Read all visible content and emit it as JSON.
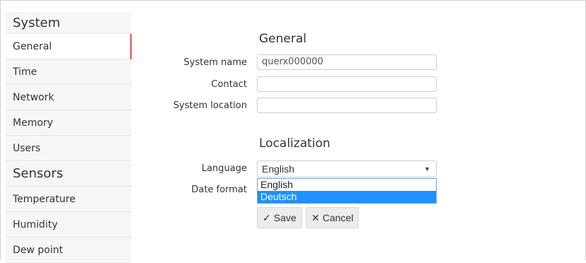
{
  "sidebar": {
    "system_header": "System",
    "system_items": [
      {
        "label": "General",
        "active": true
      },
      {
        "label": "Time"
      },
      {
        "label": "Network"
      },
      {
        "label": "Memory"
      },
      {
        "label": "Users"
      }
    ],
    "sensors_header": "Sensors",
    "sensors_items": [
      {
        "label": "Temperature"
      },
      {
        "label": "Humidity"
      },
      {
        "label": "Dew point"
      }
    ],
    "active_indicator_color": "#d9534f"
  },
  "general": {
    "title": "General",
    "system_name_label": "System name",
    "system_name_value": "querx000000",
    "contact_label": "Contact",
    "contact_value": "",
    "location_label": "System location",
    "location_value": ""
  },
  "localization": {
    "title": "Localization",
    "language_label": "Language",
    "language_selected": "English",
    "language_options": [
      "English",
      "Deutsch"
    ],
    "highlighted_option": "Deutsch",
    "date_format_label": "Date format"
  },
  "buttons": {
    "save_icon": "✓",
    "save_label": "Save",
    "cancel_icon": "✕",
    "cancel_label": "Cancel"
  },
  "colors": {
    "highlight": "#1e90ff",
    "accent": "#d9534f"
  }
}
